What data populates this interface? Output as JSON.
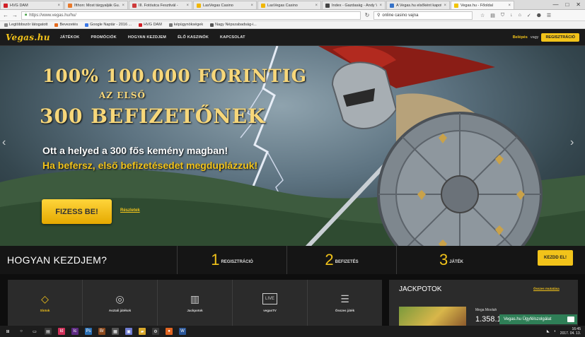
{
  "browser": {
    "tabs": [
      {
        "title": "HVG DAM",
        "color": "#d11f26",
        "active": false
      },
      {
        "title": "Ifthon: Most tárgyalják Gu...",
        "color": "#e8792b",
        "active": false
      },
      {
        "title": "III. Fotóutca Fesztivál -",
        "color": "#ce3a3a",
        "active": false
      },
      {
        "title": "LasVegas Casino",
        "color": "#f1b600",
        "active": false
      },
      {
        "title": "LasVegas Casino",
        "color": "#f1b600",
        "active": false
      },
      {
        "title": "Index - Gazdaság - Andy V...",
        "color": "#444444",
        "active": false
      },
      {
        "title": "A Vegas.hu elsőként kapot...",
        "color": "#3572c8",
        "active": false
      },
      {
        "title": "Vegas.hu - Főoldal",
        "color": "#f1c400",
        "active": true
      }
    ],
    "window_controls": {
      "minimize": "—",
      "maximize": "□",
      "close": "✕"
    },
    "url": "https://www.vegas.hu/hu/",
    "search_value": "online casino vajna",
    "bookmarks": [
      {
        "label": "Legtöbbször látogatott",
        "color": "#888888"
      },
      {
        "label": "Bevezetés",
        "color": "#e56a1e"
      },
      {
        "label": "Google Naptár - 2016 ...",
        "color": "#3b78e7"
      },
      {
        "label": "HVG DAM",
        "color": "#d11f26"
      },
      {
        "label": "képügynökségek",
        "color": "#777777"
      },
      {
        "label": "Nagy Népszabadság-i...",
        "color": "#555555"
      }
    ]
  },
  "site": {
    "logo": "Vegas.hu",
    "menu": [
      "JÁTÉKOK",
      "PROMÓCIÓK",
      "HOGYAN KEZDJEM",
      "ÉLŐ KASZINÓK",
      "KAPCSOLAT"
    ],
    "login": "Belépés",
    "or": "vagy",
    "register": "REGISZTRÁCIÓ"
  },
  "hero": {
    "headline1": "100% 100.000 FORINTIG",
    "headline2": "AZ ELSŐ",
    "headline3": "300 BEFIZETŐNEK",
    "sub1": "Ott a helyed a 300 fős kemény magban!",
    "sub2": "Ha befersz, első befizetésedet megduplázzuk!",
    "button": "FIZESS BE!",
    "terms": "Részletek",
    "arrow_left": "‹",
    "arrow_right": "›"
  },
  "howto": {
    "title": "HOGYAN KEZDJEM?",
    "steps": [
      {
        "num": "1",
        "label": "REGISZTRÁCIÓ"
      },
      {
        "num": "2",
        "label": "BEFIZETÉS"
      },
      {
        "num": "3",
        "label": "JÁTÉK"
      }
    ],
    "button": "KEZDD EL!"
  },
  "categories": [
    {
      "label": "Slotok",
      "icon": "diamond-icon",
      "glyph": "◇",
      "active": true
    },
    {
      "label": "Asztali játékok",
      "icon": "roulette-icon",
      "glyph": "◎",
      "active": false
    },
    {
      "label": "Jackpotok",
      "icon": "bar-chart-icon",
      "glyph": "▥",
      "active": false
    },
    {
      "label": "vegasTV",
      "icon": "tv-icon",
      "glyph": "LIVE",
      "active": false
    },
    {
      "label": "Összes játék",
      "icon": "list-icon",
      "glyph": "☰",
      "active": false
    }
  ],
  "jackpots": {
    "title": "JACKPOTOK",
    "all_link": "Összes mutatása",
    "game": "Mega Moolah",
    "amount": "1.358.15"
  },
  "chat": {
    "label": "Vegas.hu Ügyfélszolgálat"
  },
  "taskbar": {
    "apps": [
      {
        "name": "start-button",
        "color": "#1d1d1d",
        "glyph": "⊞"
      },
      {
        "name": "search-icon",
        "color": "#1d1d1d",
        "glyph": "○"
      },
      {
        "name": "task-view-icon",
        "color": "#1d1d1d",
        "glyph": "▭"
      },
      {
        "name": "explorer-icon",
        "color": "#3a3a3a",
        "glyph": "▤"
      },
      {
        "name": "indesign-icon",
        "color": "#d0315a",
        "glyph": "Id"
      },
      {
        "name": "incopy-icon",
        "color": "#5d2a82",
        "glyph": "Ic"
      },
      {
        "name": "photoshop-icon",
        "color": "#2b6fb3",
        "glyph": "Ps"
      },
      {
        "name": "bridge-icon",
        "color": "#8b4a1e",
        "glyph": "Br"
      },
      {
        "name": "calculator-icon",
        "color": "#555555",
        "glyph": "▦"
      },
      {
        "name": "files-icon",
        "color": "#6d7bd0",
        "glyph": "▣"
      },
      {
        "name": "folder-icon",
        "color": "#d9a92c",
        "glyph": "▰"
      },
      {
        "name": "settings-icon",
        "color": "#3a3a3a",
        "glyph": "⚙"
      },
      {
        "name": "firefox-icon",
        "color": "#e16521",
        "glyph": "●"
      },
      {
        "name": "word-icon",
        "color": "#2a5699",
        "glyph": "W"
      }
    ],
    "time": "16:45",
    "date": "2017. 04. 13."
  },
  "colors": {
    "accent": "#f2c31a",
    "nav_bg": "#1b1b1b",
    "band_bg": "#151515",
    "panel_bg": "#2b2b2b"
  }
}
